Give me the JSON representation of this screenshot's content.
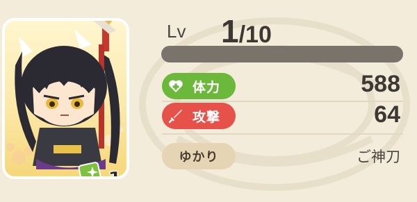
{
  "level": {
    "label": "Lv",
    "current": "1",
    "slash": "/",
    "max": "10",
    "exp_fraction": 0
  },
  "stats": {
    "hp": {
      "label": "体力",
      "value": "588",
      "icon": "heart-plus-icon",
      "color": "#6bb83a"
    },
    "attack": {
      "label": "攻撃",
      "value": "64",
      "icon": "sword-icon",
      "color": "#e6524a"
    },
    "yukari": {
      "label": "ゆかり",
      "value": "ご神刀"
    }
  },
  "card": {
    "count": "1",
    "badge_icon": "sparkle-card-icon"
  },
  "colors": {
    "background": "#f3ecdb",
    "hp_green": "#6bb83a",
    "attack_red": "#e6524a",
    "exp_bar": "#7a736c"
  }
}
